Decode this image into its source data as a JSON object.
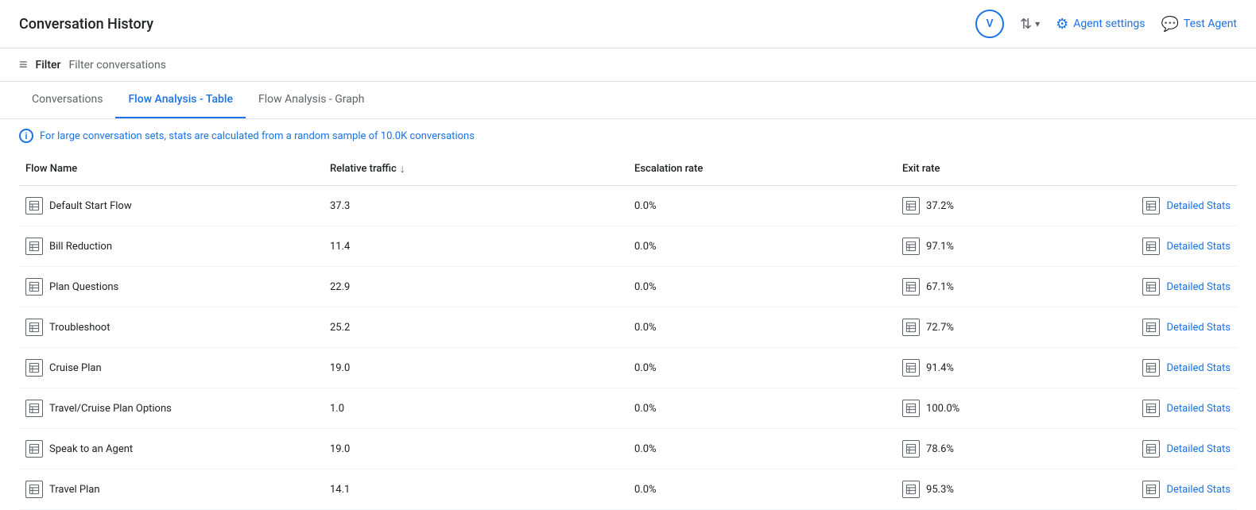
{
  "header": {
    "title": "Conversation History",
    "avatar_label": "V",
    "agent_settings_label": "Agent settings",
    "test_agent_label": "Test Agent"
  },
  "filter": {
    "label": "Filter",
    "placeholder": "Filter conversations"
  },
  "tabs": [
    {
      "id": "conversations",
      "label": "Conversations",
      "active": false
    },
    {
      "id": "flow-analysis-table",
      "label": "Flow Analysis - Table",
      "active": true
    },
    {
      "id": "flow-analysis-graph",
      "label": "Flow Analysis - Graph",
      "active": false
    }
  ],
  "info_banner": {
    "text": "For large conversation sets, stats are calculated from a random sample of 10.0K conversations"
  },
  "table": {
    "columns": [
      {
        "id": "flow-name",
        "label": "Flow Name",
        "sortable": false
      },
      {
        "id": "relative-traffic",
        "label": "Relative traffic",
        "sortable": true
      },
      {
        "id": "escalation-rate",
        "label": "Escalation rate",
        "sortable": false
      },
      {
        "id": "exit-rate",
        "label": "Exit rate",
        "sortable": false
      }
    ],
    "rows": [
      {
        "flow_name": "Default Start Flow",
        "relative_traffic": "37.3",
        "escalation_rate": "0.0%",
        "exit_rate": "37.2%"
      },
      {
        "flow_name": "Bill Reduction",
        "relative_traffic": "11.4",
        "escalation_rate": "0.0%",
        "exit_rate": "97.1%"
      },
      {
        "flow_name": "Plan Questions",
        "relative_traffic": "22.9",
        "escalation_rate": "0.0%",
        "exit_rate": "67.1%"
      },
      {
        "flow_name": "Troubleshoot",
        "relative_traffic": "25.2",
        "escalation_rate": "0.0%",
        "exit_rate": "72.7%"
      },
      {
        "flow_name": "Cruise Plan",
        "relative_traffic": "19.0",
        "escalation_rate": "0.0%",
        "exit_rate": "91.4%"
      },
      {
        "flow_name": "Travel/Cruise Plan Options",
        "relative_traffic": "1.0",
        "escalation_rate": "0.0%",
        "exit_rate": "100.0%"
      },
      {
        "flow_name": "Speak to an Agent",
        "relative_traffic": "19.0",
        "escalation_rate": "0.0%",
        "exit_rate": "78.6%"
      },
      {
        "flow_name": "Travel Plan",
        "relative_traffic": "14.1",
        "escalation_rate": "0.0%",
        "exit_rate": "95.3%"
      }
    ],
    "detailed_stats_label": "Detailed Stats"
  }
}
